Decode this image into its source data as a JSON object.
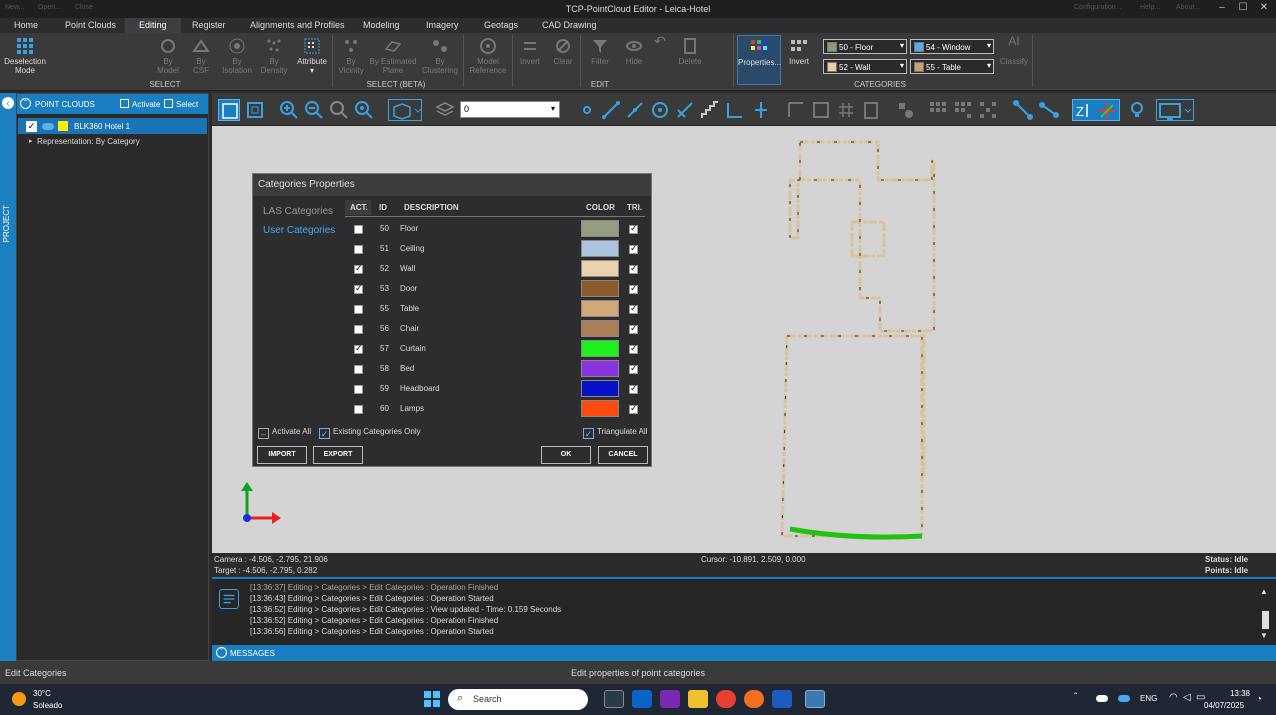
{
  "window": {
    "title": "TCP-PointCloud Editor - Leica-Hotel",
    "quick_access": [
      "New...",
      "Open...",
      "Close"
    ],
    "right_links": [
      "Configuration...",
      "Help...",
      "About..."
    ]
  },
  "menu": [
    "Home",
    "Point Clouds",
    "Editing",
    "Register",
    "Alignments and Profiles",
    "Modeling",
    "Imagery",
    "Geotags",
    "CAD Drawing"
  ],
  "menu_active": "Editing",
  "ribbon": {
    "deselection": "Deselection Mode",
    "select_label": "SELECT",
    "by_model": "By Model",
    "by_csf": "By CSF",
    "by_isolation": "By Isolation",
    "by_density": "By Density",
    "attribute": "Attribute",
    "select_beta_label": "SELECT (BETA)",
    "by_vicinity": "By Vicinity",
    "by_estimated_plane": "By Estimated Plane",
    "by_clustering": "By Clustering",
    "model_reference": "Model Reference",
    "invert": "Invert",
    "clear": "Clear",
    "filter": "Filter",
    "hide": "Hide",
    "delete": "Delete",
    "edit_label": "EDIT",
    "properties": "Properties...",
    "invert2": "Invert",
    "categories_label": "CATEGORIES",
    "classify": "Classify",
    "cat_selectors": [
      {
        "label": "50 - Floor",
        "color": "#8a9a7a"
      },
      {
        "label": "54 - Window",
        "color": "#55aaf0"
      },
      {
        "label": "52 - Wall",
        "color": "#e6cfa8"
      },
      {
        "label": "55 - Table",
        "color": "#c8a070"
      }
    ]
  },
  "project": {
    "strip_label": "PROJECT",
    "header": "POINT CLOUDS",
    "activate": "Activate",
    "select": "Select",
    "cloud_name": "BLK360 Hotel 1",
    "representation": "Representation: By Category"
  },
  "toolbar2": {
    "layer_value": "0"
  },
  "dialog": {
    "title": "Categories Properties",
    "nav_las": "LAS Categories",
    "nav_user": "User Categories",
    "headers": {
      "act": "ACT.",
      "id": "ID",
      "desc": "DESCRIPTION",
      "color": "COLOR",
      "tri": "TRI."
    },
    "rows": [
      {
        "active": false,
        "id": "50",
        "desc": "Floor",
        "color": "#959d7e",
        "tri": true
      },
      {
        "active": false,
        "id": "51",
        "desc": "Ceiling",
        "color": "#aec4dc",
        "tri": true
      },
      {
        "active": true,
        "id": "52",
        "desc": "Wall",
        "color": "#e9d2ac",
        "tri": true
      },
      {
        "active": true,
        "id": "53",
        "desc": "Door",
        "color": "#8d5a2c",
        "tri": true
      },
      {
        "active": false,
        "id": "55",
        "desc": "Table",
        "color": "#d2a878",
        "tri": true
      },
      {
        "active": false,
        "id": "56",
        "desc": "Chair",
        "color": "#a97e58",
        "tri": true
      },
      {
        "active": true,
        "id": "57",
        "desc": "Curtain",
        "color": "#1ef21a",
        "tri": true
      },
      {
        "active": false,
        "id": "58",
        "desc": "Bed",
        "color": "#8a34e0",
        "tri": true
      },
      {
        "active": false,
        "id": "59",
        "desc": "Headboard",
        "color": "#0a10c8",
        "tri": true
      },
      {
        "active": false,
        "id": "60",
        "desc": "Lamps",
        "color": "#ff4a10",
        "tri": true
      }
    ],
    "activate_all": "Activate All",
    "existing_only": "Existing Categories Only",
    "triangulate_all": "Triangulate All",
    "import": "IMPORT",
    "export": "EXPORT",
    "ok": "OK",
    "cancel": "CANCEL"
  },
  "status": {
    "camera": "Camera : -4.506, -2.795, 21.906",
    "target": "Target : -4.506, -2.795, 0.282",
    "cursor": "Cursor: -10.891, 2.509, 0.000",
    "status": "Status: Idle",
    "points": "Points: Idle"
  },
  "messages": {
    "lines": [
      "[13:36:37] Editing > Categories > Edit Categories : Operation Finished",
      "[13:36:43] Editing > Categories > Edit Categories : Operation Started",
      "[13:36:52] Editing > Categories > Edit Categories : View updated - Time: 0.159 Seconds",
      "[13:36:52] Editing > Categories > Edit Categories : Operation Finished",
      "[13:36:56] Editing > Categories > Edit Categories : Operation Started"
    ],
    "bar_label": "MESSAGES"
  },
  "statusbar": {
    "left": "Edit Categories",
    "center": "Edit properties of point categories"
  },
  "taskbar": {
    "weather_temp": "30°C",
    "weather_desc": "Soleado",
    "search": "Search",
    "lang": "ENG",
    "time": "13:38",
    "date": "04/07/2025"
  }
}
